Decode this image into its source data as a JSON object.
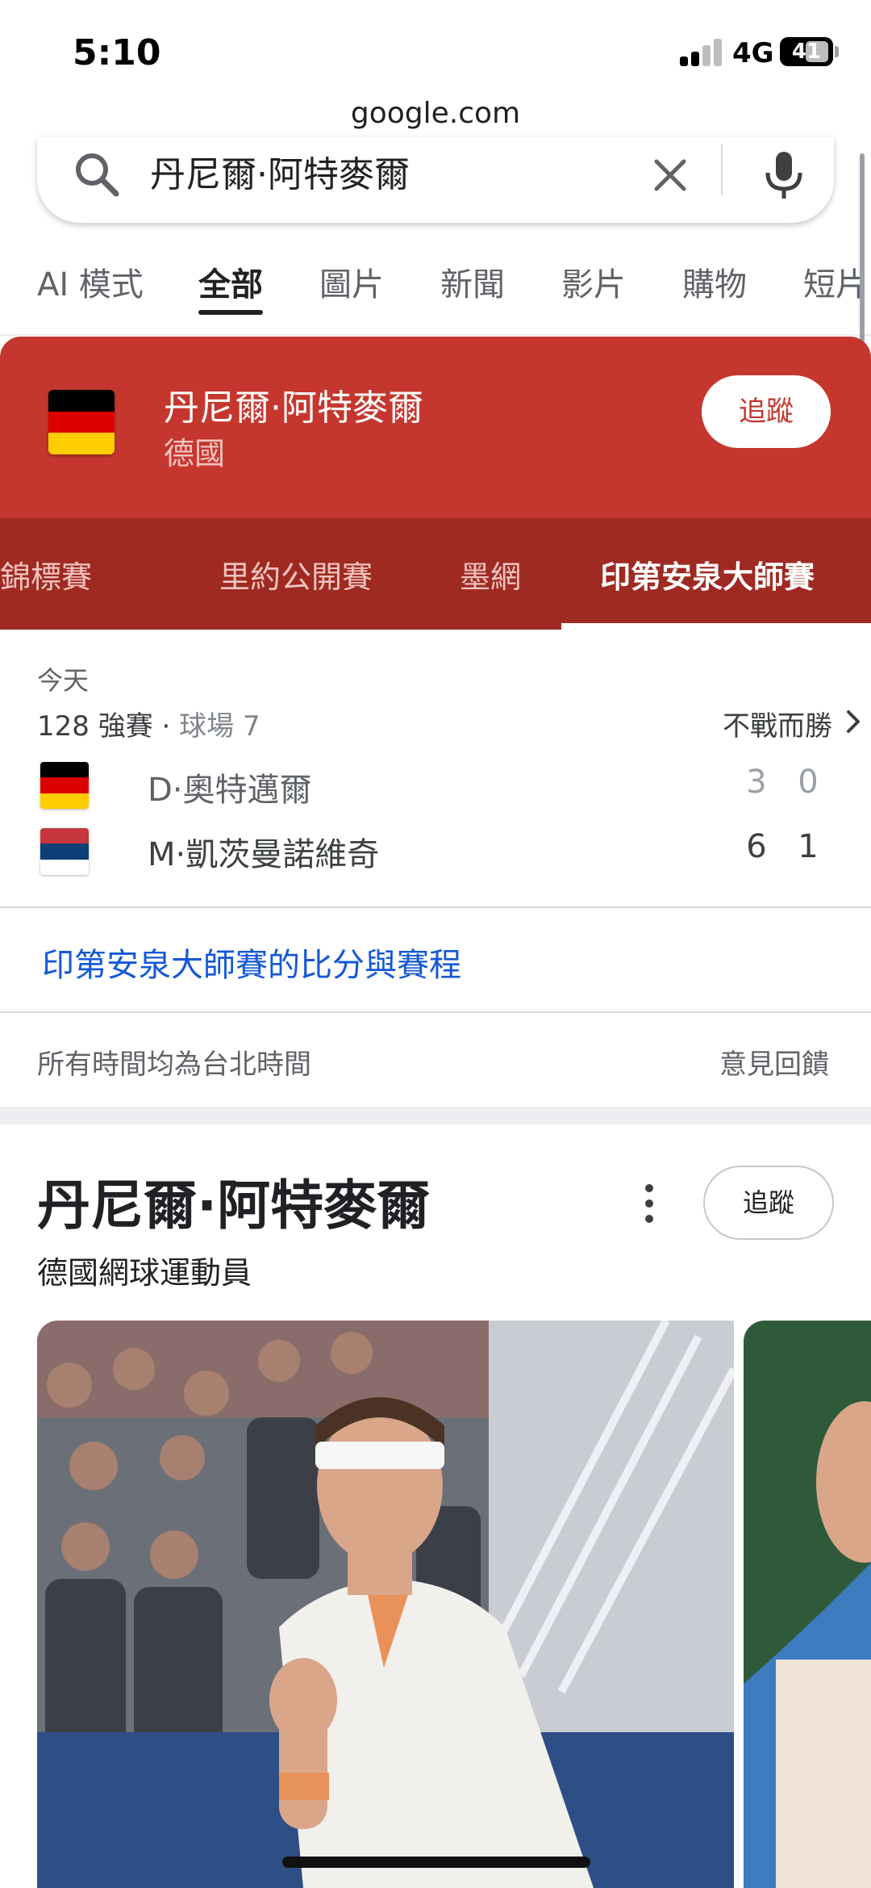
{
  "status_bar": {
    "time": "5:10",
    "network": "4G",
    "battery": "41"
  },
  "browser": {
    "url": "google.com"
  },
  "search": {
    "query": "丹尼爾·阿特麥爾",
    "search_icon": "search-icon",
    "clear_icon": "close-icon",
    "mic_icon": "mic-icon"
  },
  "tabs": [
    {
      "label": "AI 模式"
    },
    {
      "label": "全部",
      "active": true
    },
    {
      "label": "圖片"
    },
    {
      "label": "新聞"
    },
    {
      "label": "影片"
    },
    {
      "label": "購物"
    },
    {
      "label": "短片"
    }
  ],
  "sports_card": {
    "player_name": "丹尼爾·阿特麥爾",
    "country": "德國",
    "follow_label": "追蹤",
    "tournaments": [
      {
        "label": "溫布頓網球錦標賽"
      },
      {
        "label": "里約公開賽"
      },
      {
        "label": "墨網"
      },
      {
        "label": "印第安泉大師賽",
        "active": true
      }
    ],
    "match": {
      "date": "今天",
      "round": "128 強賽",
      "court": "球場 7",
      "status": "不戰而勝",
      "players": [
        {
          "name": "D·奧特邁爾",
          "flag": "germany",
          "set1": "3",
          "set2": "0"
        },
        {
          "name": "M·凱茨曼諾維奇",
          "flag": "serbia",
          "set1": "6",
          "set2": "1"
        }
      ]
    },
    "schedule_link": "印第安泉大師賽的比分與賽程",
    "timezone_note": "所有時間均為台北時間",
    "feedback": "意見回饋"
  },
  "knowledge_panel": {
    "title": "丹尼爾·阿特麥爾",
    "subtitle": "德國網球運動員",
    "follow_label": "追蹤",
    "more_icon": "more-vert-icon"
  },
  "colors": {
    "sports_red": "#c5372e",
    "sports_red_dark": "#9f2a22",
    "link_blue": "#1558d6",
    "germany_black": "#000000",
    "germany_red": "#dd0000",
    "germany_gold": "#ffce00",
    "serbia_red": "#c6363c",
    "serbia_blue": "#0c4076"
  }
}
